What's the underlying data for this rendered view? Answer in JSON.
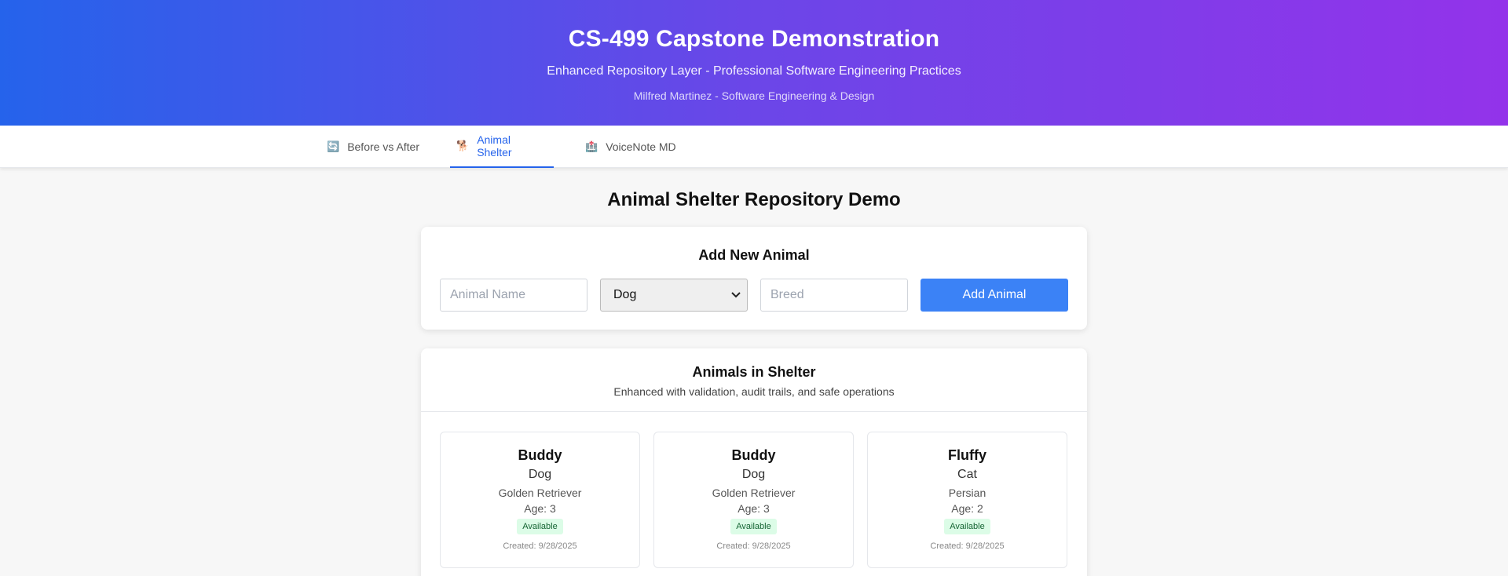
{
  "header": {
    "title": "CS-499 Capstone Demonstration",
    "subtitle": "Enhanced Repository Layer - Professional Software Engineering Practices",
    "author": "Milfred Martinez - Software Engineering & Design"
  },
  "tabs": [
    {
      "icon": "🔄",
      "label": "Before vs After",
      "active": false
    },
    {
      "icon": "🐕",
      "label": "Animal Shelter",
      "active": true
    },
    {
      "icon": "🏥",
      "label": "VoiceNote MD",
      "active": false
    }
  ],
  "page": {
    "title": "Animal Shelter Repository Demo"
  },
  "add_form": {
    "title": "Add New Animal",
    "name_placeholder": "Animal Name",
    "type_selected": "Dog",
    "breed_placeholder": "Breed",
    "submit_label": "Add Animal"
  },
  "list": {
    "title": "Animals in Shelter",
    "subtitle": "Enhanced with validation, audit trails, and safe operations",
    "animals": [
      {
        "name": "Buddy",
        "type": "Dog",
        "breed": "Golden Retriever",
        "age": "Age: 3",
        "status": "Available",
        "created": "Created: 9/28/2025"
      },
      {
        "name": "Buddy",
        "type": "Dog",
        "breed": "Golden Retriever",
        "age": "Age: 3",
        "status": "Available",
        "created": "Created: 9/28/2025"
      },
      {
        "name": "Fluffy",
        "type": "Cat",
        "breed": "Persian",
        "age": "Age: 2",
        "status": "Available",
        "created": "Created: 9/28/2025"
      }
    ]
  },
  "colors": {
    "gradient_start": "#2563eb",
    "gradient_end": "#9333ea",
    "accent": "#3b82f6",
    "badge_bg": "#dcfce7",
    "badge_text": "#166534"
  }
}
